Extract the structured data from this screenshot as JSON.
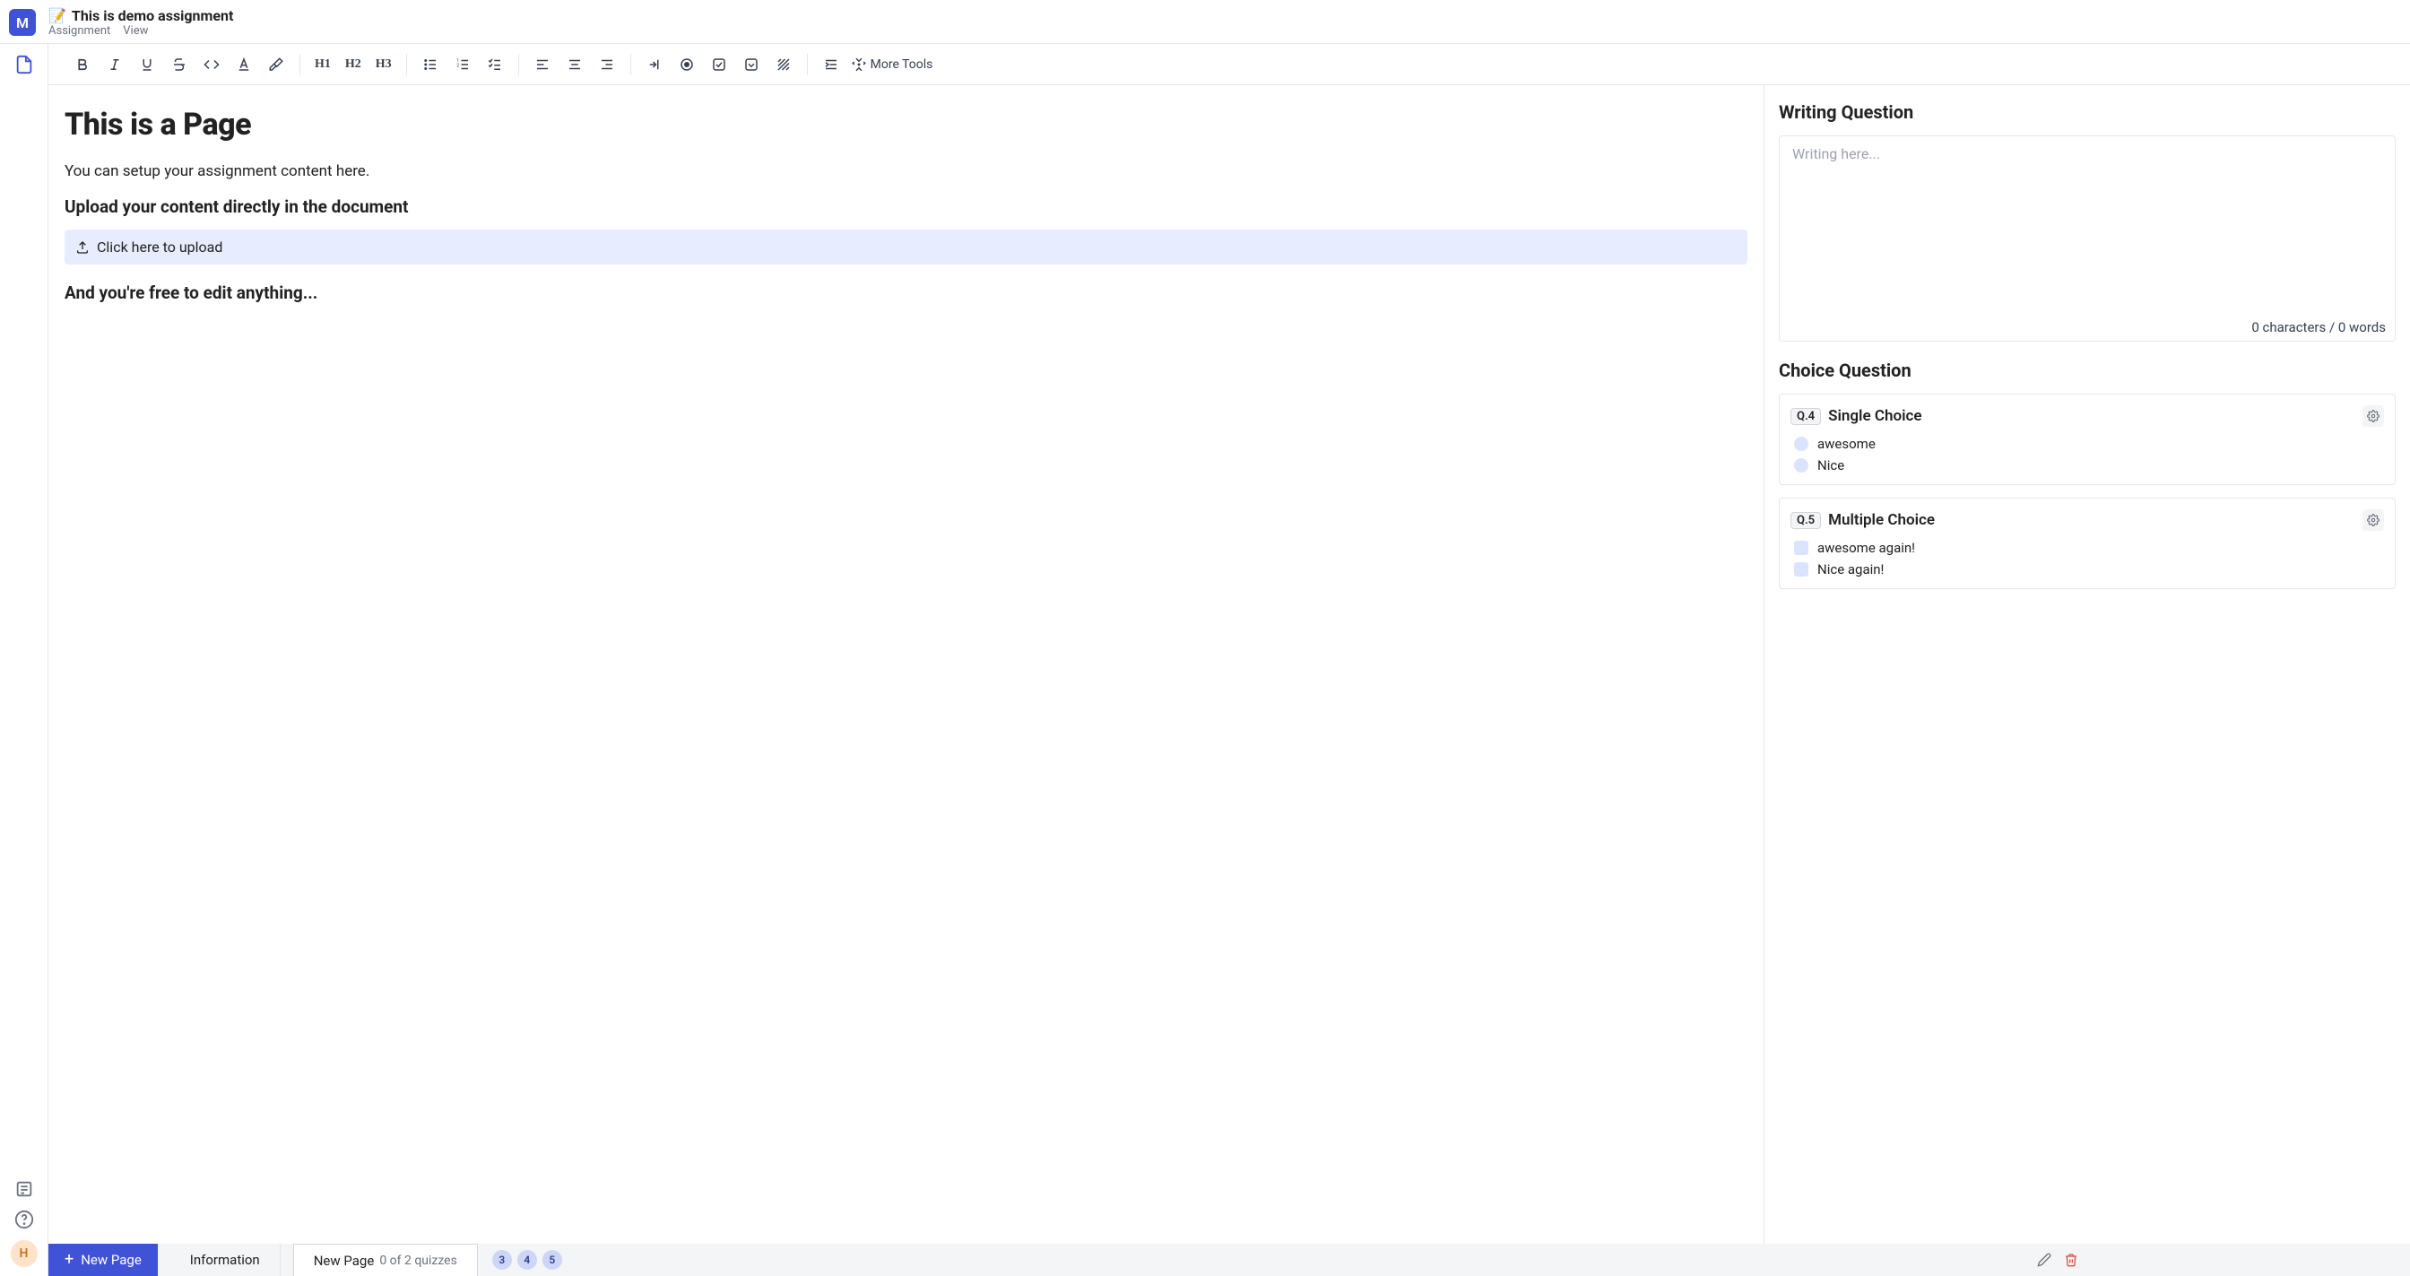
{
  "header": {
    "logo_letter": "M",
    "emoji": "📝",
    "title": "This is demo assignment",
    "menu": {
      "assignment": "Assignment",
      "view": "View"
    }
  },
  "toolbar": {
    "headings": {
      "h1": "H1",
      "h2": "H2",
      "h3": "H3"
    },
    "more_tools": "More Tools"
  },
  "editor": {
    "page_title": "This is a Page",
    "intro": "You can setup your assignment content here.",
    "upload_heading": "Upload your content directly in the document",
    "upload_label": "Click here to upload",
    "edit_heading": "And you're free to edit anything..."
  },
  "panel": {
    "writing": {
      "title": "Writing Question",
      "placeholder": "Writing here...",
      "counter": "0 characters / 0 words"
    },
    "choice": {
      "title": "Choice Question",
      "single": {
        "badge": "Q.4",
        "title": "Single Choice",
        "options": [
          "awesome",
          "Nice"
        ]
      },
      "multiple": {
        "badge": "Q.5",
        "title": "Multiple Choice",
        "options": [
          "awesome again!",
          "Nice again!"
        ]
      }
    }
  },
  "footer": {
    "new_page_btn": "New Page",
    "information_tab": "Information",
    "active_tab": {
      "label": "New Page",
      "quiz_count": "0 of 2 quizzes"
    },
    "badges": [
      "3",
      "4",
      "5"
    ]
  },
  "avatar": {
    "letter": "H"
  }
}
